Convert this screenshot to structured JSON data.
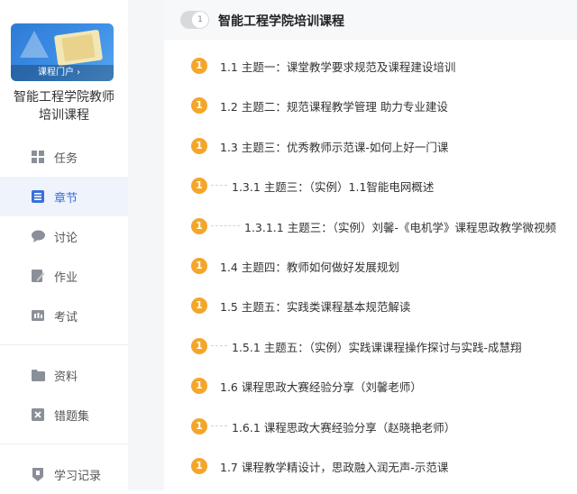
{
  "sidebar": {
    "cover_link": "课程门户",
    "course_name_line1": "智能工程学院教师",
    "course_name_line2": "培训课程",
    "items": [
      {
        "label": "任务",
        "icon": "task-grid-icon"
      },
      {
        "label": "章节",
        "icon": "chapter-list-icon",
        "active": true
      },
      {
        "label": "讨论",
        "icon": "discussion-bubble-icon"
      },
      {
        "label": "作业",
        "icon": "homework-pen-icon"
      },
      {
        "label": "考试",
        "icon": "exam-paper-icon"
      },
      {
        "label": "资料",
        "icon": "folder-icon"
      },
      {
        "label": "错题集",
        "icon": "mistake-book-icon"
      },
      {
        "label": "学习记录",
        "icon": "study-record-icon"
      }
    ]
  },
  "chapter": {
    "number": "1",
    "title": "智能工程学院培训课程",
    "sections": [
      {
        "badge": "1",
        "text": "1.1 主题一：课堂教学要求规范及课程建设培训"
      },
      {
        "badge": "1",
        "text": "1.2 主题二：规范课程教学管理 助力专业建设"
      },
      {
        "badge": "1",
        "text": "1.3 主题三：优秀教师示范课-如何上好一门课"
      },
      {
        "badge": "1",
        "text": "1.3.1 主题三：（实例）1.1智能电网概述"
      },
      {
        "badge": "1",
        "text": "1.3.1.1 主题三：（实例）刘馨-《电机学》课程思政教学微视频"
      },
      {
        "badge": "1",
        "text": "1.4 主题四：教师如何做好发展规划"
      },
      {
        "badge": "1",
        "text": "1.5 主题五：实践类课程基本规范解读"
      },
      {
        "badge": "1",
        "text": "1.5.1 主题五：（实例）实践课课程操作探讨与实践-成慧翔"
      },
      {
        "badge": "1",
        "text": "1.6 课程思政大赛经验分享（刘馨老师）"
      },
      {
        "badge": "1",
        "text": "1.6.1 课程思政大赛经验分享（赵晓艳老师）"
      },
      {
        "badge": "1",
        "text": "1.7 课程教学精设计，思政融入润无声-示范课"
      }
    ]
  },
  "colors": {
    "accent": "#3a6fd8",
    "badge": "#f4a62a"
  }
}
